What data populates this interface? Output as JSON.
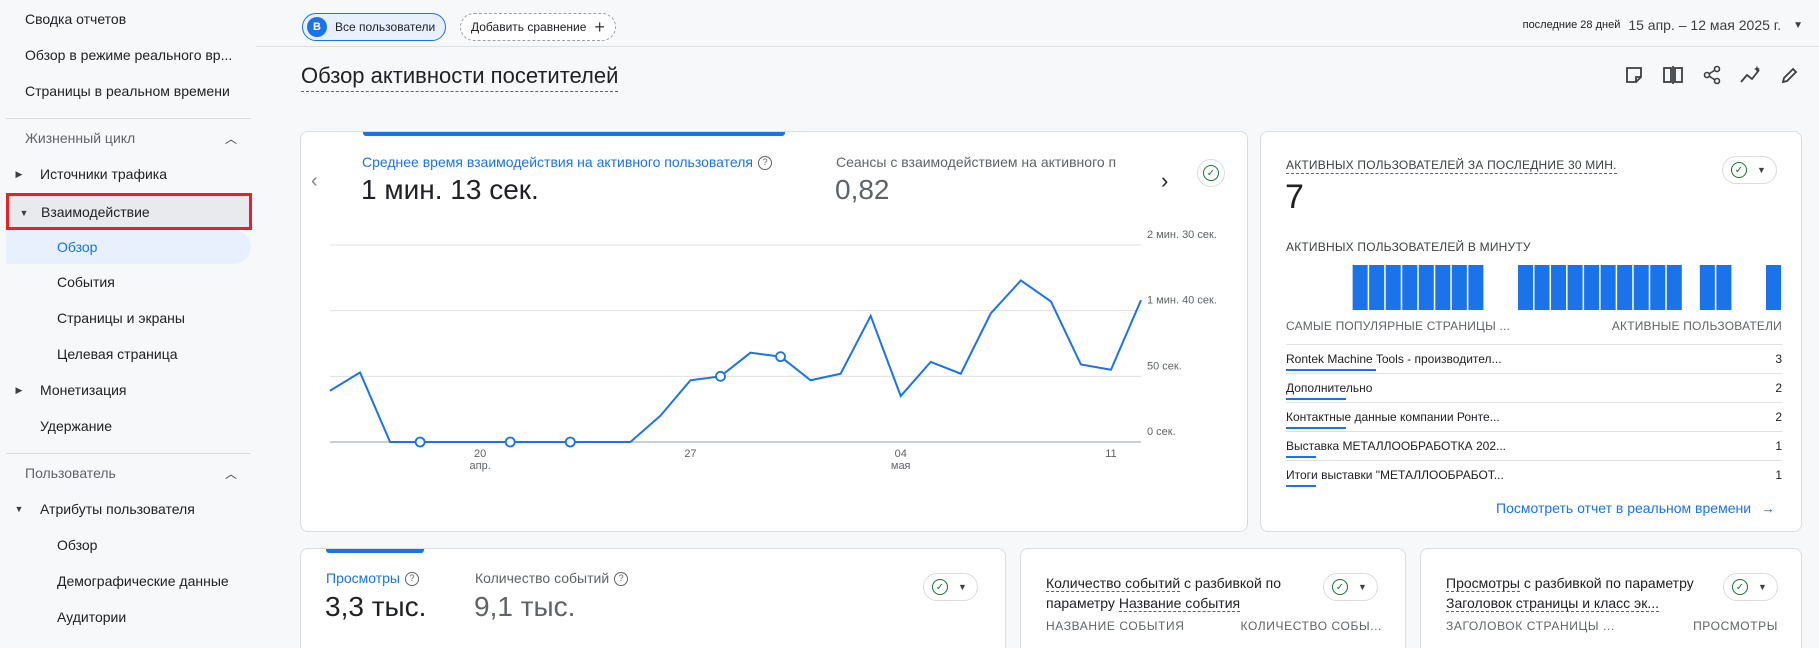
{
  "sidebar": {
    "top_items": [
      "Сводка отчетов",
      "Обзор в режиме реального вр...",
      "Страницы в реальном времени"
    ],
    "lifecycle": {
      "label": "Жизненный цикл",
      "traffic": "Источники трафика",
      "engagement": "Взаимодействие",
      "engagement_children": [
        "Обзор",
        "События",
        "Страницы и экраны",
        "Целевая страница"
      ],
      "monetization": "Монетизация",
      "retention": "Удержание"
    },
    "user": {
      "label": "Пользователь",
      "attributes": "Атрибуты пользователя",
      "attributes_children": [
        "Обзор",
        "Демографические данные",
        "Аудитории"
      ]
    }
  },
  "topbar": {
    "segment_badge": "B",
    "segment_label": "Все пользователи",
    "add_compare": "Добавить сравнение",
    "date_label": "последние 28 дней",
    "date_range": "15 апр. – 12 мая 2025 г."
  },
  "page_title": "Обзор активности посетителей",
  "main_chart_card": {
    "metric1_label": "Среднее время взаимодействия на активного пользователя",
    "metric1_value": "1 мин. 13 сек.",
    "metric2_label": "Сеансы с взаимодействием на активного поль:",
    "metric2_value": "0,82",
    "y_ticks": [
      "2 мин. 30 сек.",
      "1 мин. 40 сек.",
      "50 сек.",
      "0 сек."
    ],
    "x_ticks": [
      {
        "day": "20",
        "month": "апр."
      },
      {
        "day": "27",
        "month": ""
      },
      {
        "day": "04",
        "month": "мая"
      },
      {
        "day": "11",
        "month": ""
      }
    ]
  },
  "chart_data": {
    "type": "line",
    "x": [
      "15 апр.",
      "16 апр.",
      "17 апр.",
      "18 апр.",
      "19 апр.",
      "20 апр.",
      "21 апр.",
      "22 апр.",
      "23 апр.",
      "24 апр.",
      "25 апр.",
      "26 апр.",
      "27 апр.",
      "28 апр.",
      "29 апр.",
      "30 апр.",
      "1 мая",
      "2 мая",
      "3 мая",
      "4 мая",
      "5 мая",
      "6 мая",
      "7 мая",
      "8 мая",
      "9 мая",
      "10 мая",
      "11 мая",
      "12 мая"
    ],
    "series": [
      {
        "values": [
          39,
          53,
          0,
          0,
          0,
          0,
          0,
          0,
          0,
          0,
          0,
          20,
          47,
          50,
          68,
          65,
          47,
          52,
          96,
          35,
          61,
          52,
          98,
          123,
          107,
          59,
          55,
          108
        ]
      }
    ],
    "ylim": [
      0,
      150
    ],
    "y_unit": "seconds"
  },
  "realtime_card": {
    "title": "АКТИВНЫХ ПОЛЬЗОВАТЕЛЕЙ ЗА ПОСЛЕДНИЕ 30 МИН.",
    "value": "7",
    "per_minute_label": "АКТИВНЫХ ПОЛЬЗОВАТЕЛЕЙ В МИНУТУ",
    "per_minute": [
      0,
      0,
      0,
      0,
      1,
      1,
      1,
      1,
      1,
      1,
      1,
      1,
      0,
      0,
      1,
      1,
      1,
      1,
      1,
      1,
      1,
      1,
      1,
      1,
      0,
      1,
      1,
      0,
      0,
      1
    ],
    "col_pages": "САМЫЕ ПОПУЛЯРНЫЕ СТРАНИЦЫ ...",
    "col_users": "АКТИВНЫЕ ПОЛЬЗОВАТЕЛИ",
    "rows": [
      {
        "name": "Rontek Machine Tools - производител...",
        "value": "3",
        "share": 1.0
      },
      {
        "name": "Дополнительно",
        "value": "2",
        "share": 0.67
      },
      {
        "name": "Контактные данные компании Ронте...",
        "value": "2",
        "share": 0.67
      },
      {
        "name": "Выставка МЕТАЛЛООБРАБОТКА 202...",
        "value": "1",
        "share": 0.33
      },
      {
        "name": "Итоги выставки \"МЕТАЛЛООБРАБОТ...",
        "value": "1",
        "share": 0.33
      }
    ],
    "link": "Посмотреть отчет в реальном времени"
  },
  "views_card": {
    "label1": "Просмотры",
    "value1": "3,3 тыс.",
    "label2": "Количество событий",
    "value2": "9,1 тыс."
  },
  "events_card": {
    "title_a": "Количество событий",
    "title_b": " с разбивкой по",
    "title_c": "параметру ",
    "title_d": "Название события",
    "col1": "НАЗВАНИЕ СОБЫТИЯ",
    "col2": "КОЛИЧЕСТВО СОБЫ..."
  },
  "pages_card": {
    "title_a": "Просмотры",
    "title_b": " с разбивкой по параметру",
    "title_c": "Заголовок страницы и класс эк...",
    "col1": "ЗАГОЛОВОК СТРАНИЦЫ ...",
    "col2": "ПРОСМОТРЫ"
  },
  "colors": {
    "accent": "#1a73e8",
    "highlight": "#e8202a",
    "success": "#137333"
  }
}
